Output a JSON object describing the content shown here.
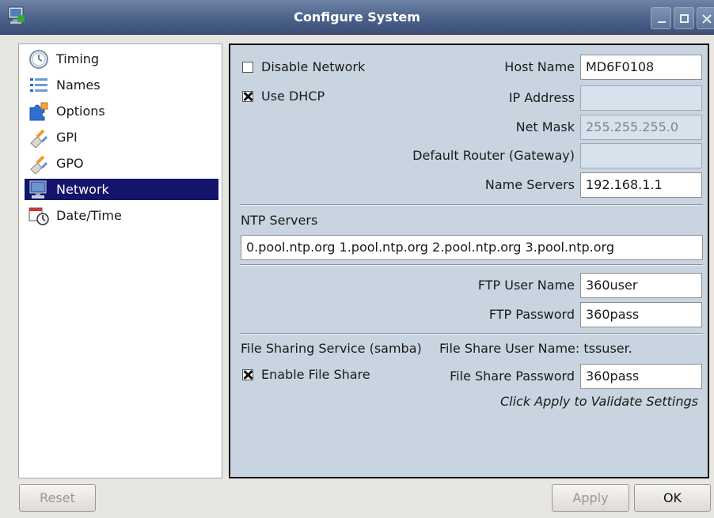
{
  "window": {
    "title": "Configure System",
    "title_bar_color": "#4b6189"
  },
  "sidebar": {
    "selected_color": "#14146b",
    "items": [
      {
        "label": "Timing",
        "icon": "clock-icon"
      },
      {
        "label": "Names",
        "icon": "list-icon"
      },
      {
        "label": "Options",
        "icon": "puzzle-icon"
      },
      {
        "label": "GPI",
        "icon": "plug-icon"
      },
      {
        "label": "GPO",
        "icon": "plug-icon"
      },
      {
        "label": "Network",
        "icon": "computer-icon",
        "selected": true
      },
      {
        "label": "Date/Time",
        "icon": "calendar-clock-icon"
      }
    ]
  },
  "network": {
    "disable_network": {
      "label": "Disable Network",
      "checked": false
    },
    "use_dhcp": {
      "label": "Use DHCP",
      "checked": true
    },
    "host_name": {
      "label": "Host Name",
      "value": "MD6F0108"
    },
    "ip_address": {
      "label": "IP Address",
      "value": ""
    },
    "net_mask": {
      "label": "Net Mask",
      "value": "255.255.255.0"
    },
    "default_router": {
      "label": "Default Router (Gateway)",
      "value": ""
    },
    "name_servers": {
      "label": "Name Servers",
      "value": "192.168.1.1"
    },
    "ntp_servers": {
      "label": "NTP Servers",
      "value": "0.pool.ntp.org  1.pool.ntp.org  2.pool.ntp.org  3.pool.ntp.org"
    },
    "ftp_user_name": {
      "label": "FTP User Name",
      "value": "360user"
    },
    "ftp_password": {
      "label": "FTP Password",
      "value": "360pass"
    },
    "file_sharing_label": "File Sharing Service (samba)",
    "file_share_user": "File Share User Name: tssuser.",
    "enable_file_share": {
      "label": "Enable File Share",
      "checked": true
    },
    "file_share_password": {
      "label": "File Share Password",
      "value": "360pass"
    },
    "hint": "Click Apply to Validate Settings",
    "panel_color": "#c8d5e1"
  },
  "buttons": {
    "reset": "Reset",
    "apply": "Apply",
    "ok": "OK"
  }
}
